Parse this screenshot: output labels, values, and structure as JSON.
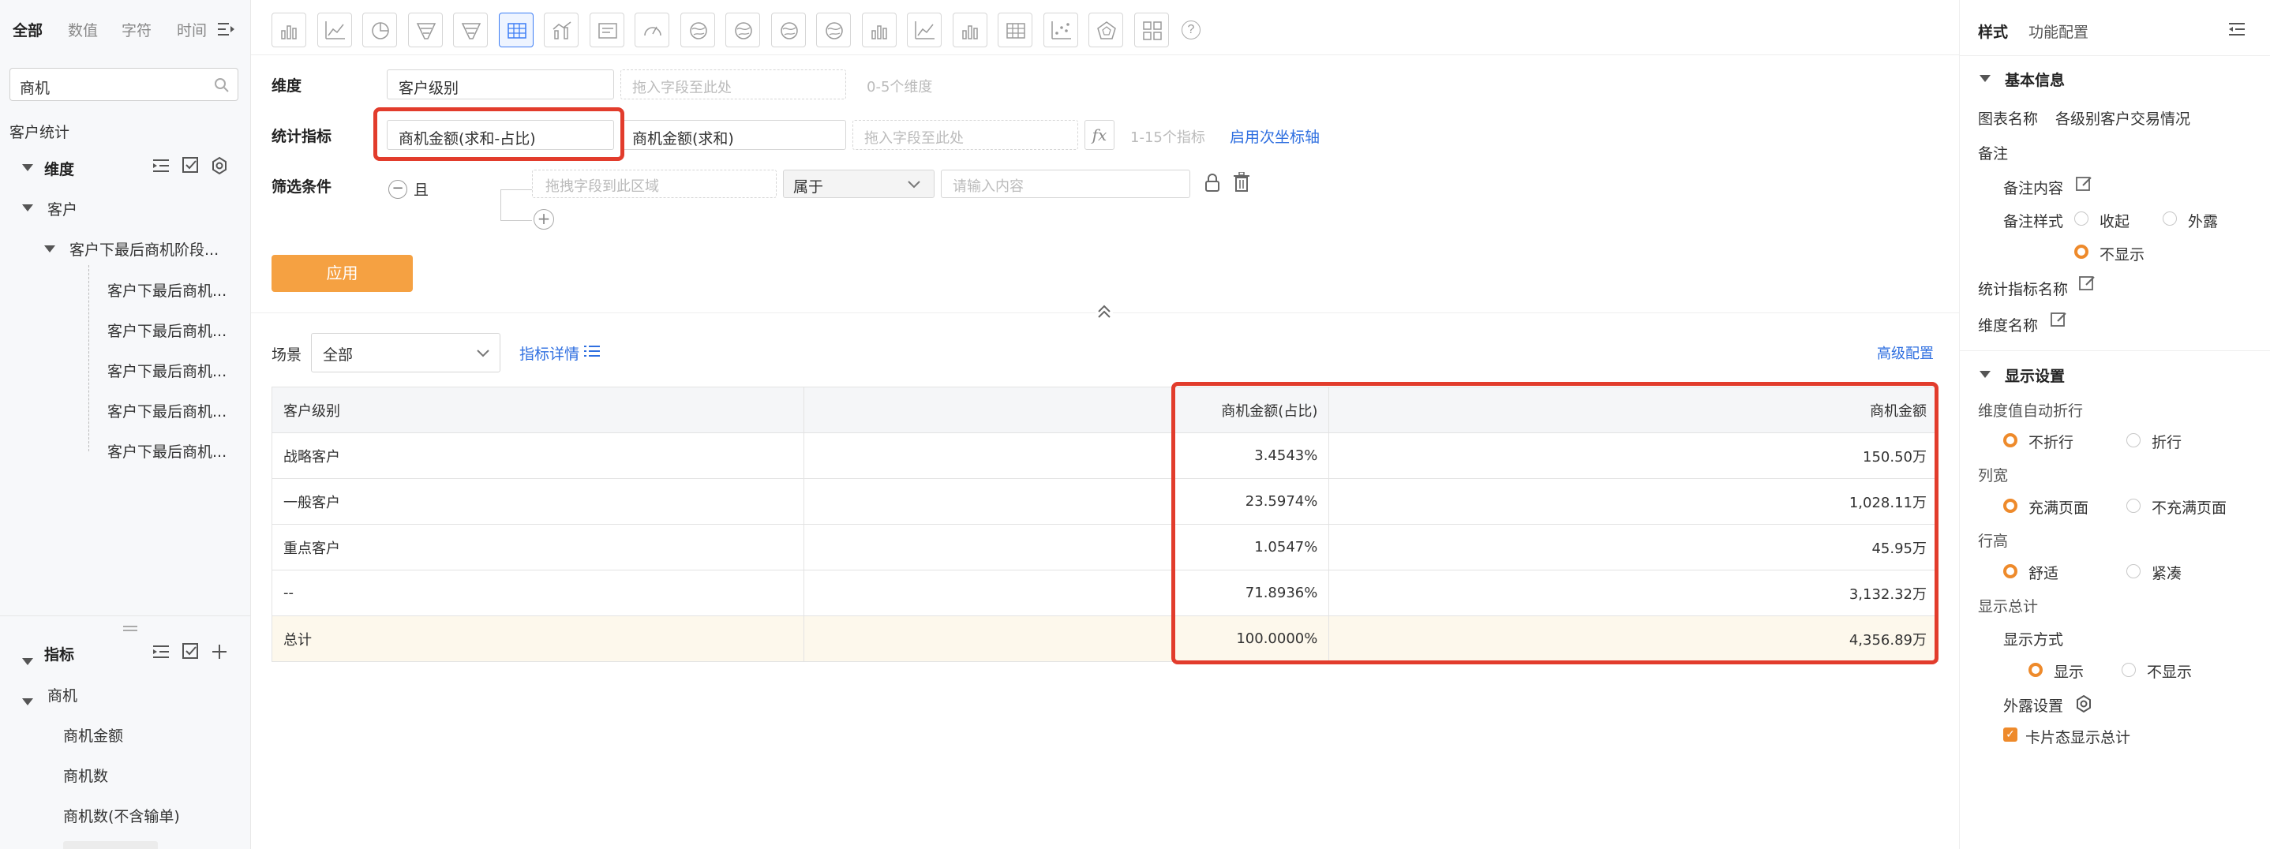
{
  "left": {
    "tabs": [
      "全部",
      "数值",
      "字符",
      "时间"
    ],
    "search_value": "商机",
    "section_label": "客户统计",
    "dimension_label": "维度",
    "customer_group": "客户",
    "stage_group": "客户下最后商机阶段...",
    "stage_items": [
      "客户下最后商机...",
      "客户下最后商机...",
      "客户下最后商机...",
      "客户下最后商机...",
      "客户下最后商机..."
    ],
    "indicator_label": "指标",
    "opportunity_group": "商机",
    "indicator_items": [
      "商机金额",
      "商机数",
      "商机数(不含输单)"
    ]
  },
  "config": {
    "dimension_label": "维度",
    "dimension_value": "客户级别",
    "dimension_placeholder": "拖入字段至此处",
    "dimension_hint": "0-5个维度",
    "metric_label": "统计指标",
    "metric_1": "商机金额(求和-占比)",
    "metric_2": "商机金额(求和)",
    "metric_placeholder": "拖入字段至此处",
    "fx": "fx",
    "metric_hint": "1-15个指标",
    "secondary_axis": "启用次坐标轴",
    "filter_label": "筛选条件",
    "filter_logic": "且",
    "filter_field_placeholder": "拖拽字段到此区域",
    "filter_operator": "属于",
    "filter_value_placeholder": "请输入内容",
    "apply_label": "应用"
  },
  "scene": {
    "label": "场景",
    "value": "全部",
    "metric_detail": "指标详情",
    "advanced": "高级配置"
  },
  "table": {
    "headers": [
      "客户级别",
      "",
      "商机金额(占比)",
      "商机金额"
    ],
    "rows": [
      [
        "战略客户",
        "",
        "3.4543%",
        "150.50万"
      ],
      [
        "一般客户",
        "",
        "23.5974%",
        "1,028.11万"
      ],
      [
        "重点客户",
        "",
        "1.0547%",
        "45.95万"
      ],
      [
        "--",
        "",
        "71.8936%",
        "3,132.32万"
      ]
    ],
    "total": [
      "总计",
      "",
      "100.0000%",
      "4,356.89万"
    ]
  },
  "right": {
    "tab_style": "样式",
    "tab_function": "功能配置",
    "basic_info": "基本信息",
    "chart_name_label": "图表名称",
    "chart_name_value": "各级别客户交易情况",
    "remark": "备注",
    "remark_content": "备注内容",
    "remark_style": "备注样式",
    "opt_collapse": "收起",
    "opt_expose": "外露",
    "opt_hide": "不显示",
    "metric_name": "统计指标名称",
    "dimension_name": "维度名称",
    "display_settings": "显示设置",
    "auto_wrap": "维度值自动折行",
    "no_wrap": "不折行",
    "wrap": "折行",
    "col_width": "列宽",
    "fill_page": "充满页面",
    "not_fill_page": "不充满页面",
    "row_height": "行高",
    "comfortable": "舒适",
    "compact": "紧凑",
    "show_total": "显示总计",
    "display_mode": "显示方式",
    "show": "显示",
    "not_show": "不显示",
    "expose_settings": "外露设置",
    "card_total": "卡片态显示总计"
  }
}
